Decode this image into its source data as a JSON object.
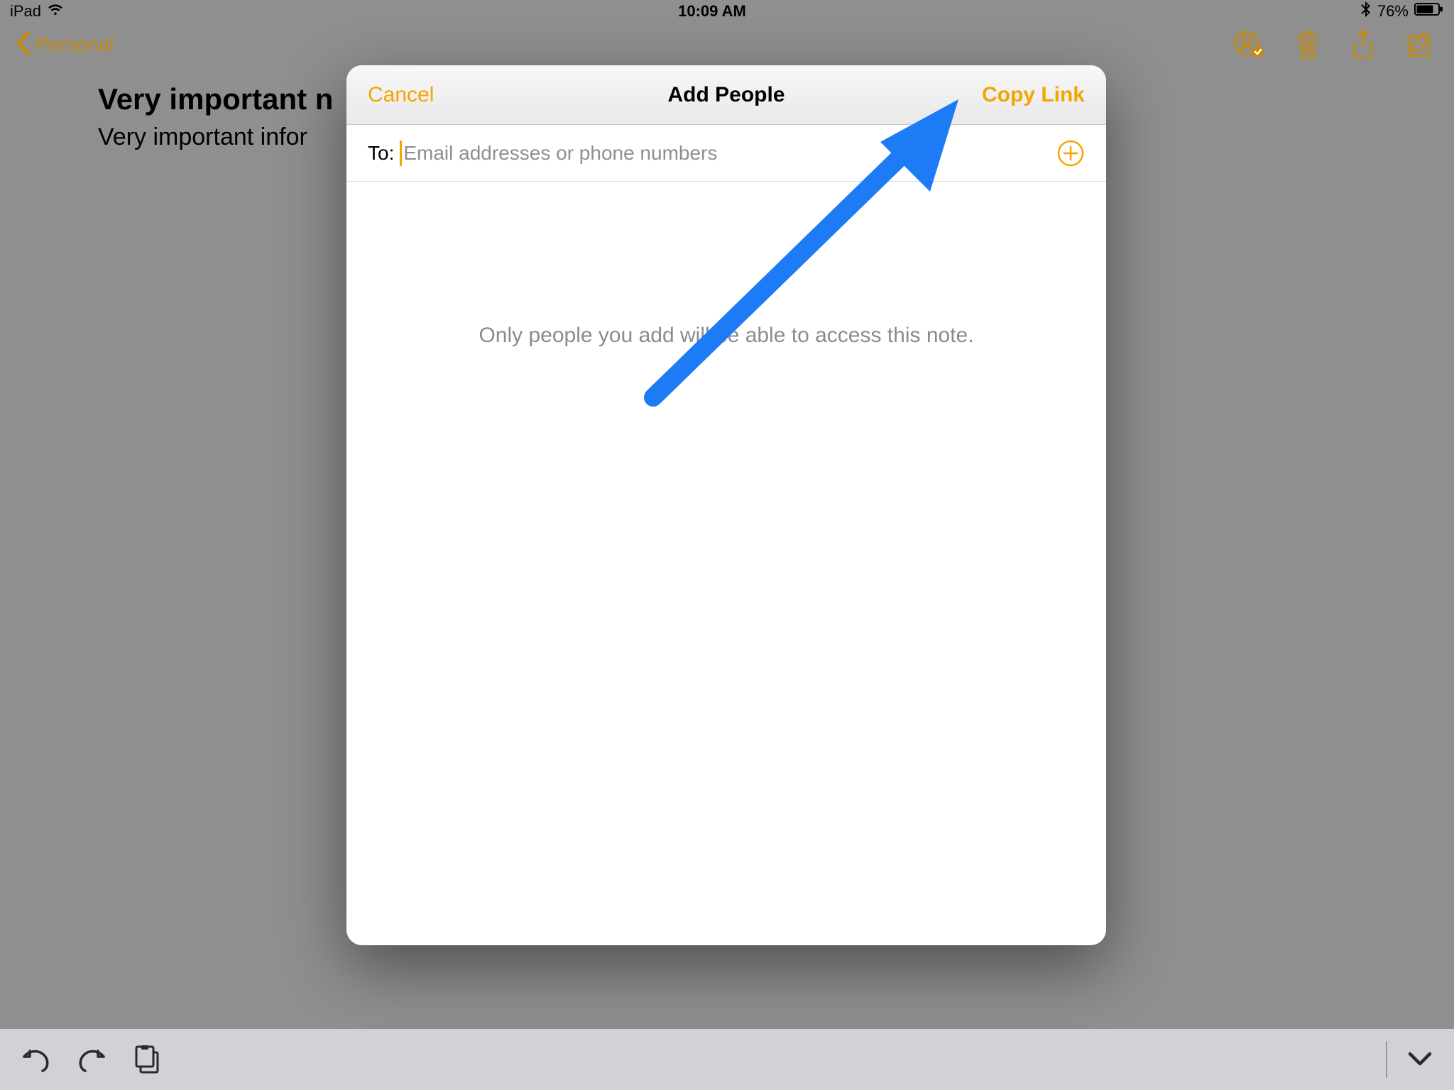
{
  "statusbar": {
    "device": "iPad",
    "time": "10:09 AM",
    "battery": "76%"
  },
  "header": {
    "back_label": "Personal"
  },
  "note": {
    "title": "Very important n",
    "body": "Very important infor"
  },
  "modal": {
    "cancel": "Cancel",
    "title": "Add People",
    "action": "Copy Link",
    "to_label": "To:",
    "to_placeholder": "Email addresses or phone numbers",
    "info_text": "Only people you add will be able to access this note."
  },
  "colors": {
    "accent": "#f5a500",
    "arrow": "#1d7bf6"
  }
}
